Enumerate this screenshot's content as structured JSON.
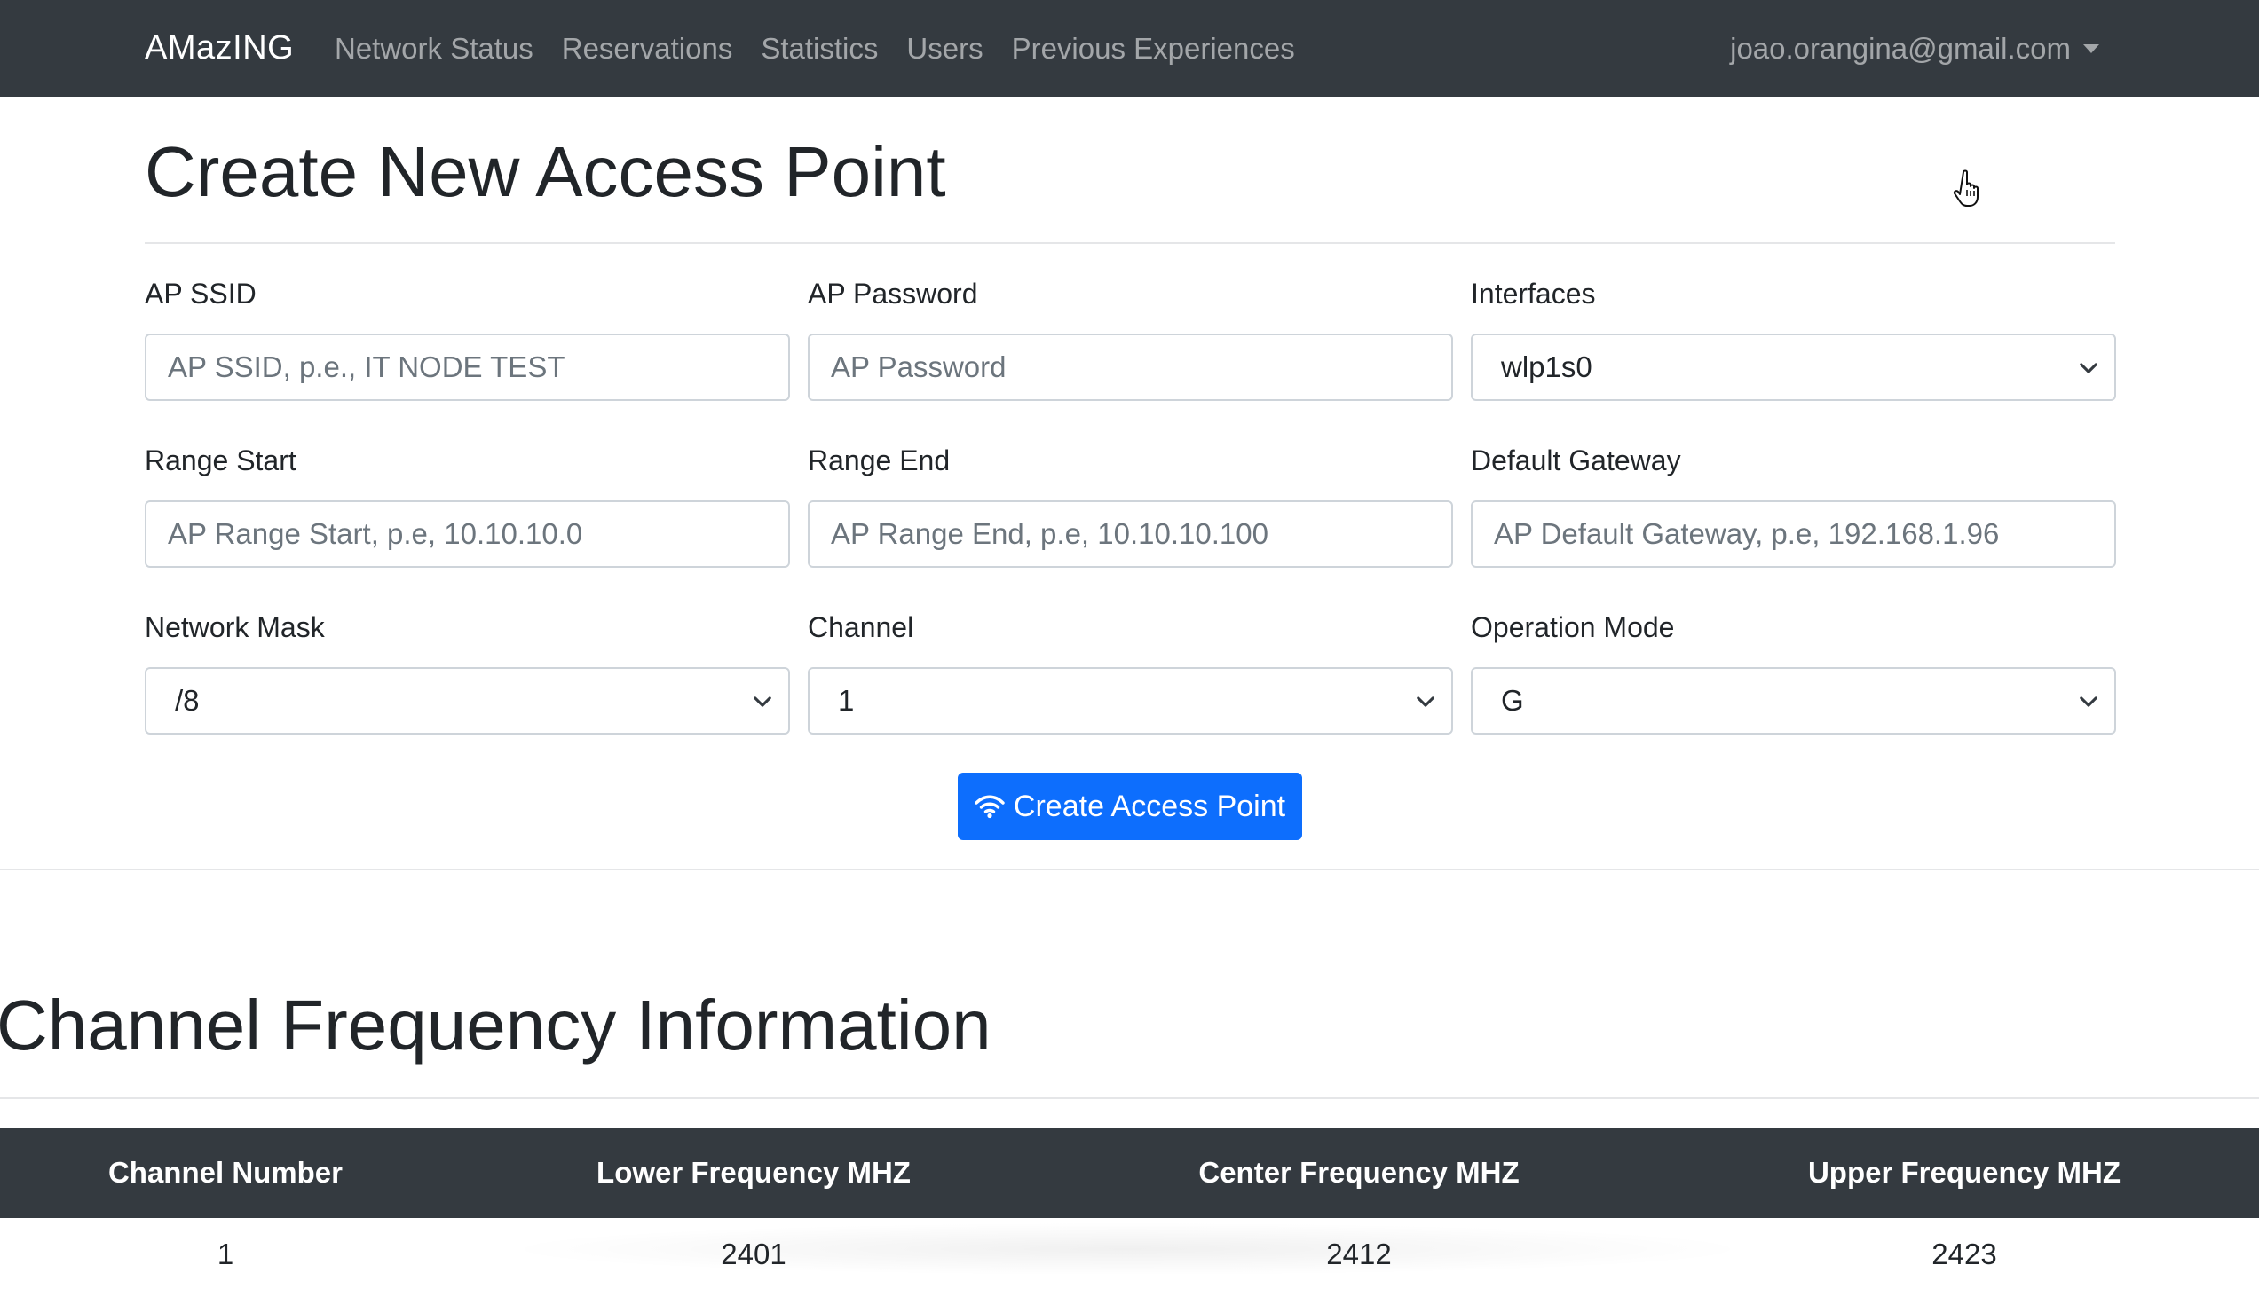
{
  "navbar": {
    "brand": "AMazING",
    "links": [
      "Network Status",
      "Reservations",
      "Statistics",
      "Users",
      "Previous Experiences"
    ],
    "user_email": "joao.orangina@gmail.com"
  },
  "page": {
    "title": "Create New Access Point"
  },
  "form": {
    "ap_ssid": {
      "label": "AP SSID",
      "placeholder": "AP SSID, p.e., IT NODE TEST"
    },
    "ap_password": {
      "label": "AP Password",
      "placeholder": "AP Password"
    },
    "interfaces": {
      "label": "Interfaces",
      "value": "wlp1s0"
    },
    "range_start": {
      "label": "Range Start",
      "placeholder": "AP Range Start, p.e, 10.10.10.0"
    },
    "range_end": {
      "label": "Range End",
      "placeholder": "AP Range End, p.e, 10.10.10.100"
    },
    "default_gateway": {
      "label": "Default Gateway",
      "placeholder": "AP Default Gateway, p.e, 192.168.1.96"
    },
    "network_mask": {
      "label": "Network Mask",
      "value": "/8"
    },
    "channel": {
      "label": "Channel",
      "value": "1"
    },
    "operation_mode": {
      "label": "Operation Mode",
      "value": "G"
    },
    "submit_label": "Create Access Point"
  },
  "channel_section": {
    "title": "Channel Frequency Information",
    "columns": [
      "Channel Number",
      "Lower Frequency MHZ",
      "Center Frequency MHZ",
      "Upper Frequency MHZ"
    ],
    "rows": [
      [
        "1",
        "2401",
        "2412",
        "2423"
      ]
    ]
  },
  "colors": {
    "navbar_bg": "#343a40",
    "primary": "#0d6efd",
    "table_head_bg": "#343a40"
  },
  "icons": {
    "submit": "wifi-icon",
    "cursor": "hand-pointer-icon",
    "select_chevron": "chevron-down-icon"
  }
}
